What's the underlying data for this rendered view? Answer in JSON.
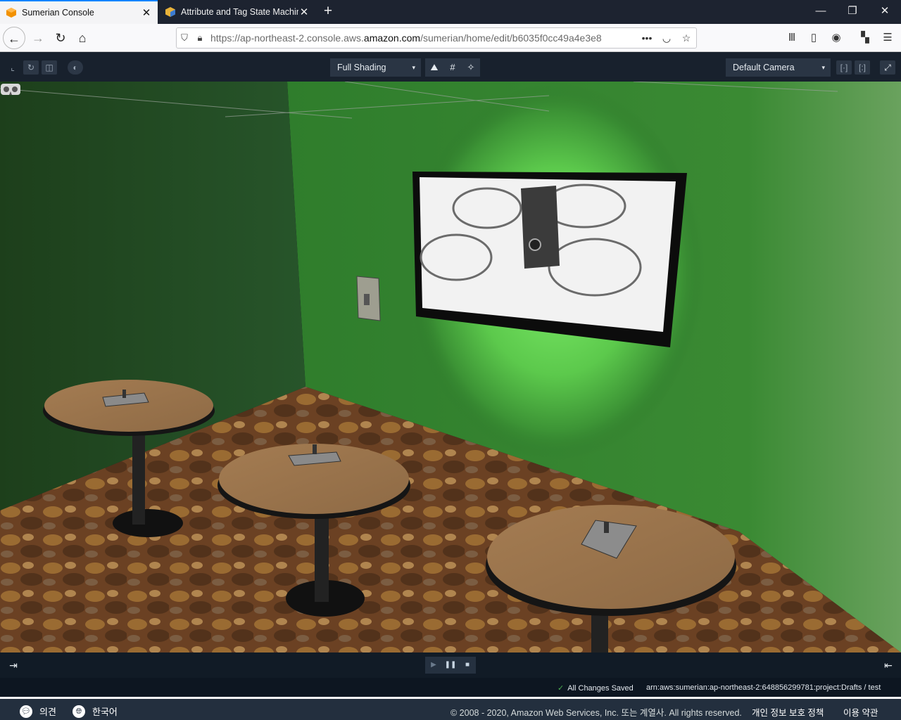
{
  "browser": {
    "tabs": [
      {
        "title": "Sumerian Console",
        "close": "✕"
      },
      {
        "title": "Attribute and Tag State Machine",
        "close": "✕"
      }
    ],
    "new_tab": "+",
    "window_controls": {
      "minimize": "—",
      "restore": "❐",
      "close": "✕"
    },
    "url_prefix": "https://ap-northeast-2.console.aws.",
    "url_domain": "amazon.com",
    "url_suffix": "/sumerian/home/edit/b6035f0cc49a4e3e8",
    "more": "•••",
    "icons": [
      "library-icon",
      "sidebar-icon",
      "account-icon",
      "extensions-icon",
      "menu-icon"
    ]
  },
  "toolbar": {
    "left_icons": [
      "transform-icon",
      "rotate-icon",
      "scale-icon",
      "world-icon"
    ],
    "shading": "Full Shading",
    "view_icons": {
      "environment": "⛰",
      "grid": "#",
      "effects": "✧"
    },
    "camera": "Default Camera",
    "caret": "▾",
    "right_icons": [
      "fit-icon",
      "fit-selection-icon",
      "fullscreen-icon"
    ]
  },
  "scene": {
    "vr_icon": "vr-headset-icon",
    "wall_color": "#2e7a2b",
    "spotlight_color": "#6fe05c"
  },
  "playback": {
    "play": "▶",
    "pause": "❚❚",
    "stop": "■"
  },
  "status": {
    "saved_check": "✓",
    "saved": "All Changes Saved",
    "arn": "arn:aws:sumerian:ap-northeast-2:648856299781:project:Drafts  /  test"
  },
  "footer": {
    "feedback": "의견",
    "language": "한국어",
    "copyright": "© 2008 - 2020, Amazon Web Services, Inc. 또는 계열사. All rights reserved.",
    "privacy": "개인 정보 보호 정책",
    "terms": "이용 약관"
  }
}
